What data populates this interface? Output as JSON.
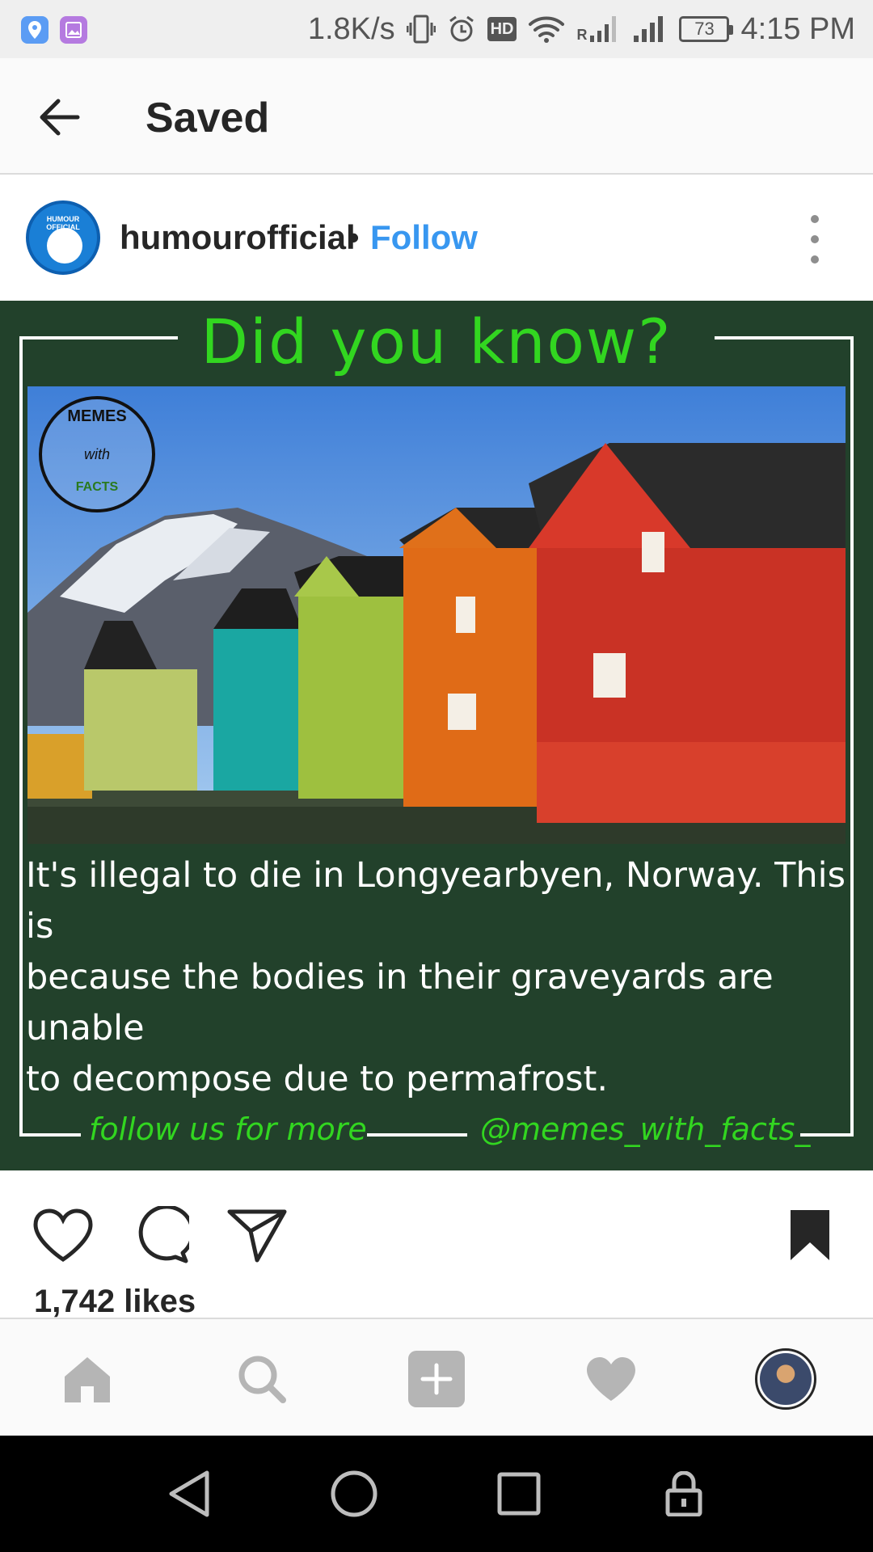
{
  "status_bar": {
    "speed": "1.8K/s",
    "hd": "HD",
    "signal_r": "R",
    "battery": "73",
    "time": "4:15 PM"
  },
  "header": {
    "title": "Saved"
  },
  "post": {
    "avatar_text": "HUMOUR OFFICIAL",
    "username": "humourofficial",
    "separator": "•",
    "follow_label": "Follow",
    "image": {
      "heading": "Did you know?",
      "badge_top": "MEMES",
      "badge_mid": "with",
      "badge_bottom": "FACTS",
      "caption_lines": [
        "It's illegal to die in Longyearbyen, Norway. This is",
        "because the bodies in their graveyards are unable",
        "to decompose due to permafrost."
      ],
      "footer_left": "follow us for more",
      "footer_right": "@memes_with_facts_"
    },
    "likes": "1,742 likes"
  },
  "icons": {
    "status_left": [
      "location-app-icon",
      "gallery-app-icon"
    ],
    "status_right": [
      "vibrate-icon",
      "alarm-icon",
      "hd-icon",
      "wifi-icon",
      "signal-icon",
      "signal-icon",
      "battery-icon"
    ],
    "actions": [
      "heart-icon",
      "comment-icon",
      "share-icon",
      "bookmark-icon"
    ],
    "bottom_nav": [
      "home-icon",
      "search-icon",
      "add-icon",
      "activity-icon",
      "profile-avatar"
    ],
    "system_nav": [
      "back-icon",
      "home-circle-icon",
      "recents-icon",
      "lock-icon"
    ]
  },
  "colors": {
    "follow": "#3897f0",
    "image_bg": "#22412b",
    "accent_green": "#32d620"
  }
}
